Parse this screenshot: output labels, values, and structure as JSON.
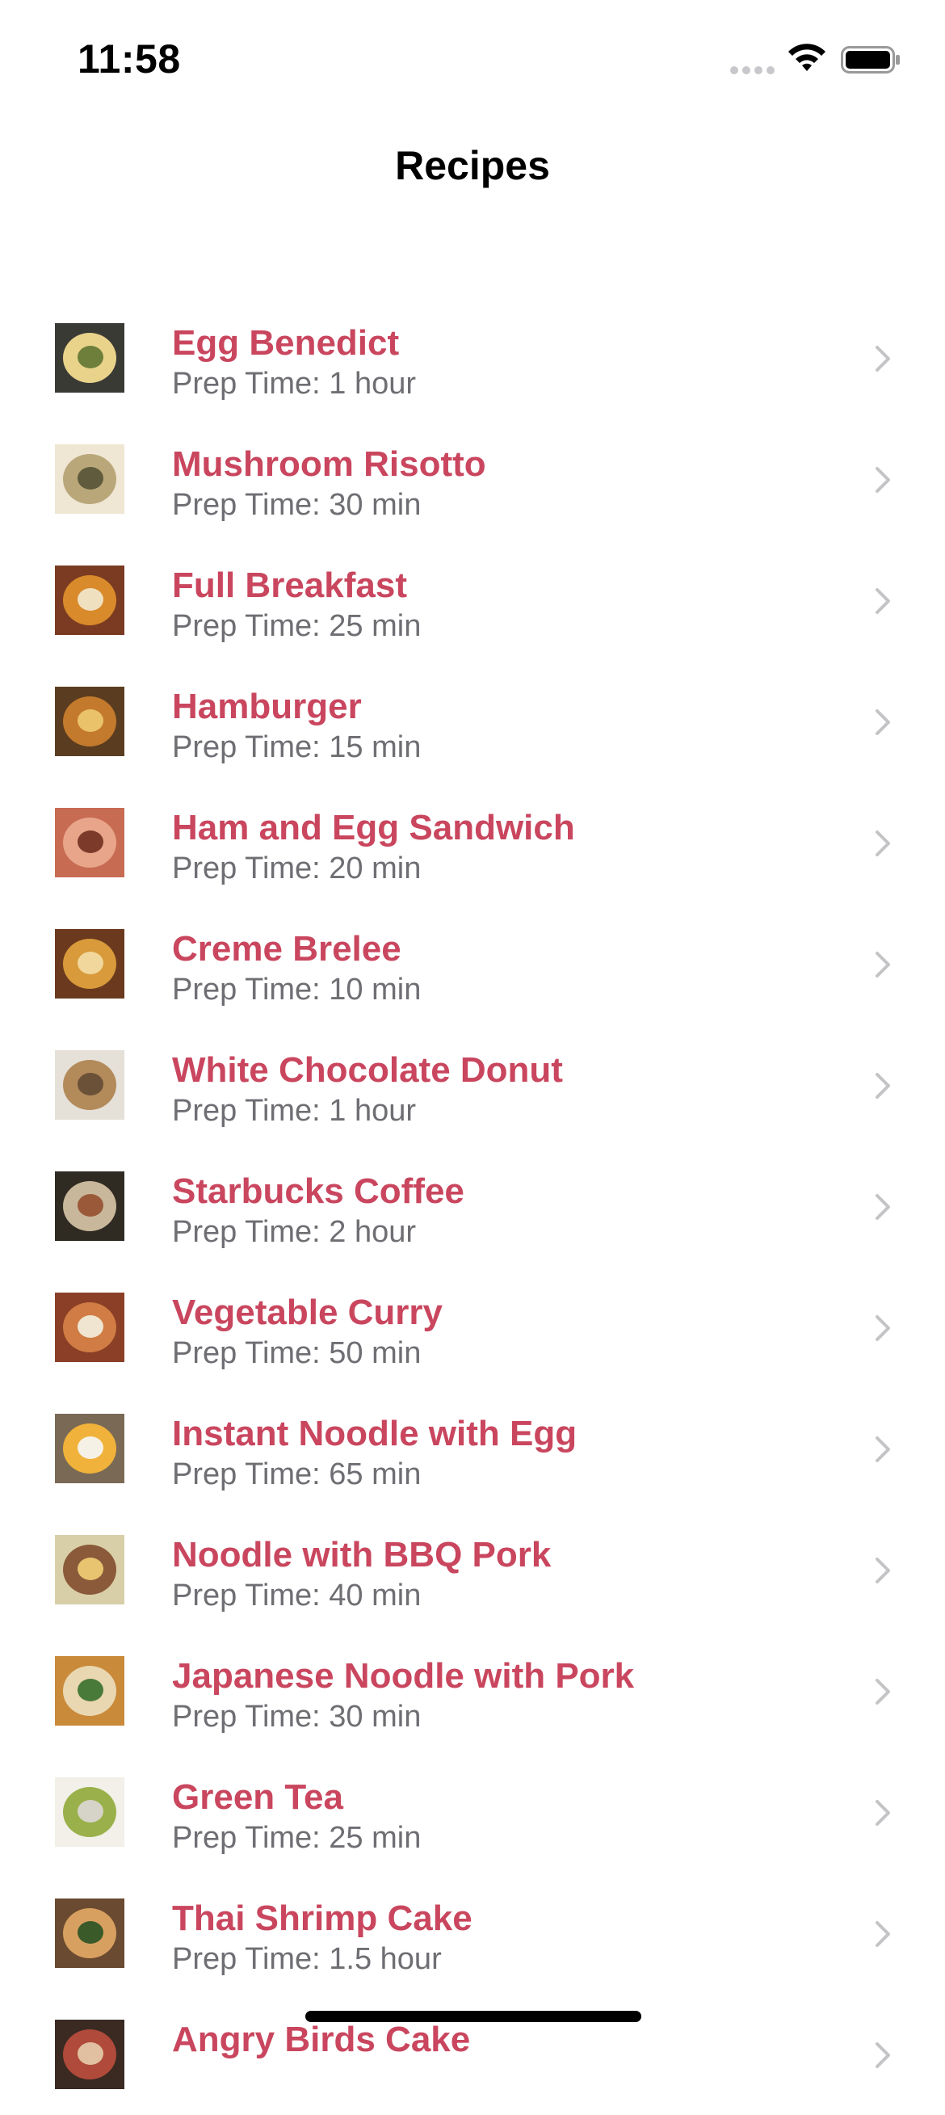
{
  "status_bar": {
    "time": "11:58"
  },
  "nav": {
    "title": "Recipes"
  },
  "icons": {
    "chevron": "chevron-right-icon",
    "wifi": "wifi-icon",
    "battery": "battery-icon",
    "signal": "cellular-signal-icon"
  },
  "colors": {
    "accent": "#c9465e",
    "secondary_text": "#6e6e73"
  },
  "recipes": [
    {
      "name": "Egg Benedict",
      "prep_time": "Prep Time: 1 hour"
    },
    {
      "name": "Mushroom Risotto",
      "prep_time": "Prep Time: 30 min"
    },
    {
      "name": "Full Breakfast",
      "prep_time": "Prep Time: 25 min"
    },
    {
      "name": "Hamburger",
      "prep_time": "Prep Time: 15 min"
    },
    {
      "name": "Ham and Egg Sandwich",
      "prep_time": "Prep Time: 20 min"
    },
    {
      "name": "Creme Brelee",
      "prep_time": "Prep Time: 10 min"
    },
    {
      "name": "White Chocolate Donut",
      "prep_time": "Prep Time: 1 hour"
    },
    {
      "name": "Starbucks Coffee",
      "prep_time": "Prep Time: 2 hour"
    },
    {
      "name": "Vegetable Curry",
      "prep_time": "Prep Time: 50 min"
    },
    {
      "name": "Instant Noodle with Egg",
      "prep_time": "Prep Time: 65 min"
    },
    {
      "name": "Noodle with BBQ Pork",
      "prep_time": "Prep Time: 40 min"
    },
    {
      "name": "Japanese Noodle with Pork",
      "prep_time": "Prep Time: 30 min"
    },
    {
      "name": "Green Tea",
      "prep_time": "Prep Time: 25 min"
    },
    {
      "name": "Thai Shrimp Cake",
      "prep_time": "Prep Time: 1.5 hour"
    },
    {
      "name": "Angry Birds Cake",
      "prep_time": ""
    }
  ]
}
